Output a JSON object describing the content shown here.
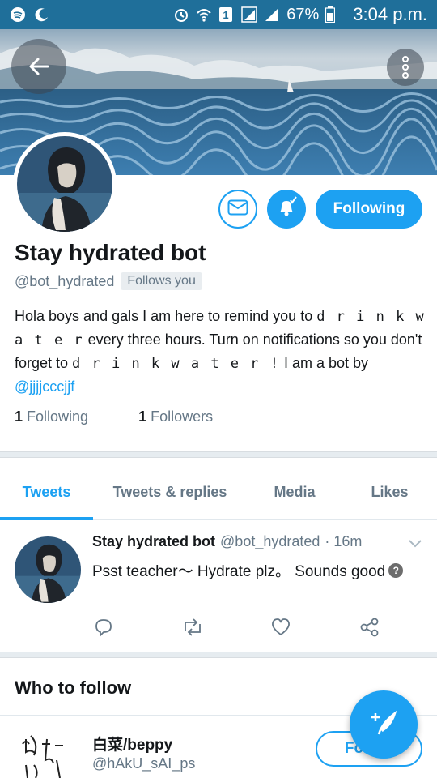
{
  "status_bar": {
    "battery_percent": "67%",
    "time": "3:04 p.m.",
    "sim_label": "1",
    "icons": [
      "spotify-icon",
      "moon-icon",
      "alarm-icon",
      "wifi-icon",
      "signal-icon",
      "battery-icon"
    ]
  },
  "header": {
    "back_icon": "arrow-left-icon",
    "more_icon": "more-vertical-icon"
  },
  "profile": {
    "name": "Stay hydrated bot",
    "handle": "@bot_hydrated",
    "follows_you": "Follows you",
    "following_button": "Following",
    "bio_part1": "Hola boys and gals I am here to remind you to ",
    "bio_spaced1": "d r i n k w a t e r",
    "bio_part2": " every three hours. Turn on notifications so you don't forget to ",
    "bio_spaced2": "d r i n k w a t e r !",
    "bio_part3": " I am a bot by ",
    "bio_link": "@jjjjcccjjf",
    "following_count": "1",
    "following_label": "Following",
    "followers_count": "1",
    "followers_label": "Followers"
  },
  "tabs": [
    {
      "label": "Tweets",
      "active": true
    },
    {
      "label": "Tweets & replies",
      "active": false
    },
    {
      "label": "Media",
      "active": false
    },
    {
      "label": "Likes",
      "active": false
    }
  ],
  "tweet": {
    "name": "Stay hydrated bot",
    "handle": "@bot_hydrated",
    "time": "· 16m",
    "text": "Psst teacher〜 Hydrate plz。 Sounds good",
    "emoji": "?"
  },
  "who_to_follow": {
    "title": "Who to follow",
    "name": "白菜/beppy",
    "handle": "@hAkU_sAI_ps",
    "follow_button": "Follow"
  },
  "colors": {
    "accent": "#1da1f2",
    "status_bar": "#1f6f9a",
    "muted": "#657786"
  }
}
